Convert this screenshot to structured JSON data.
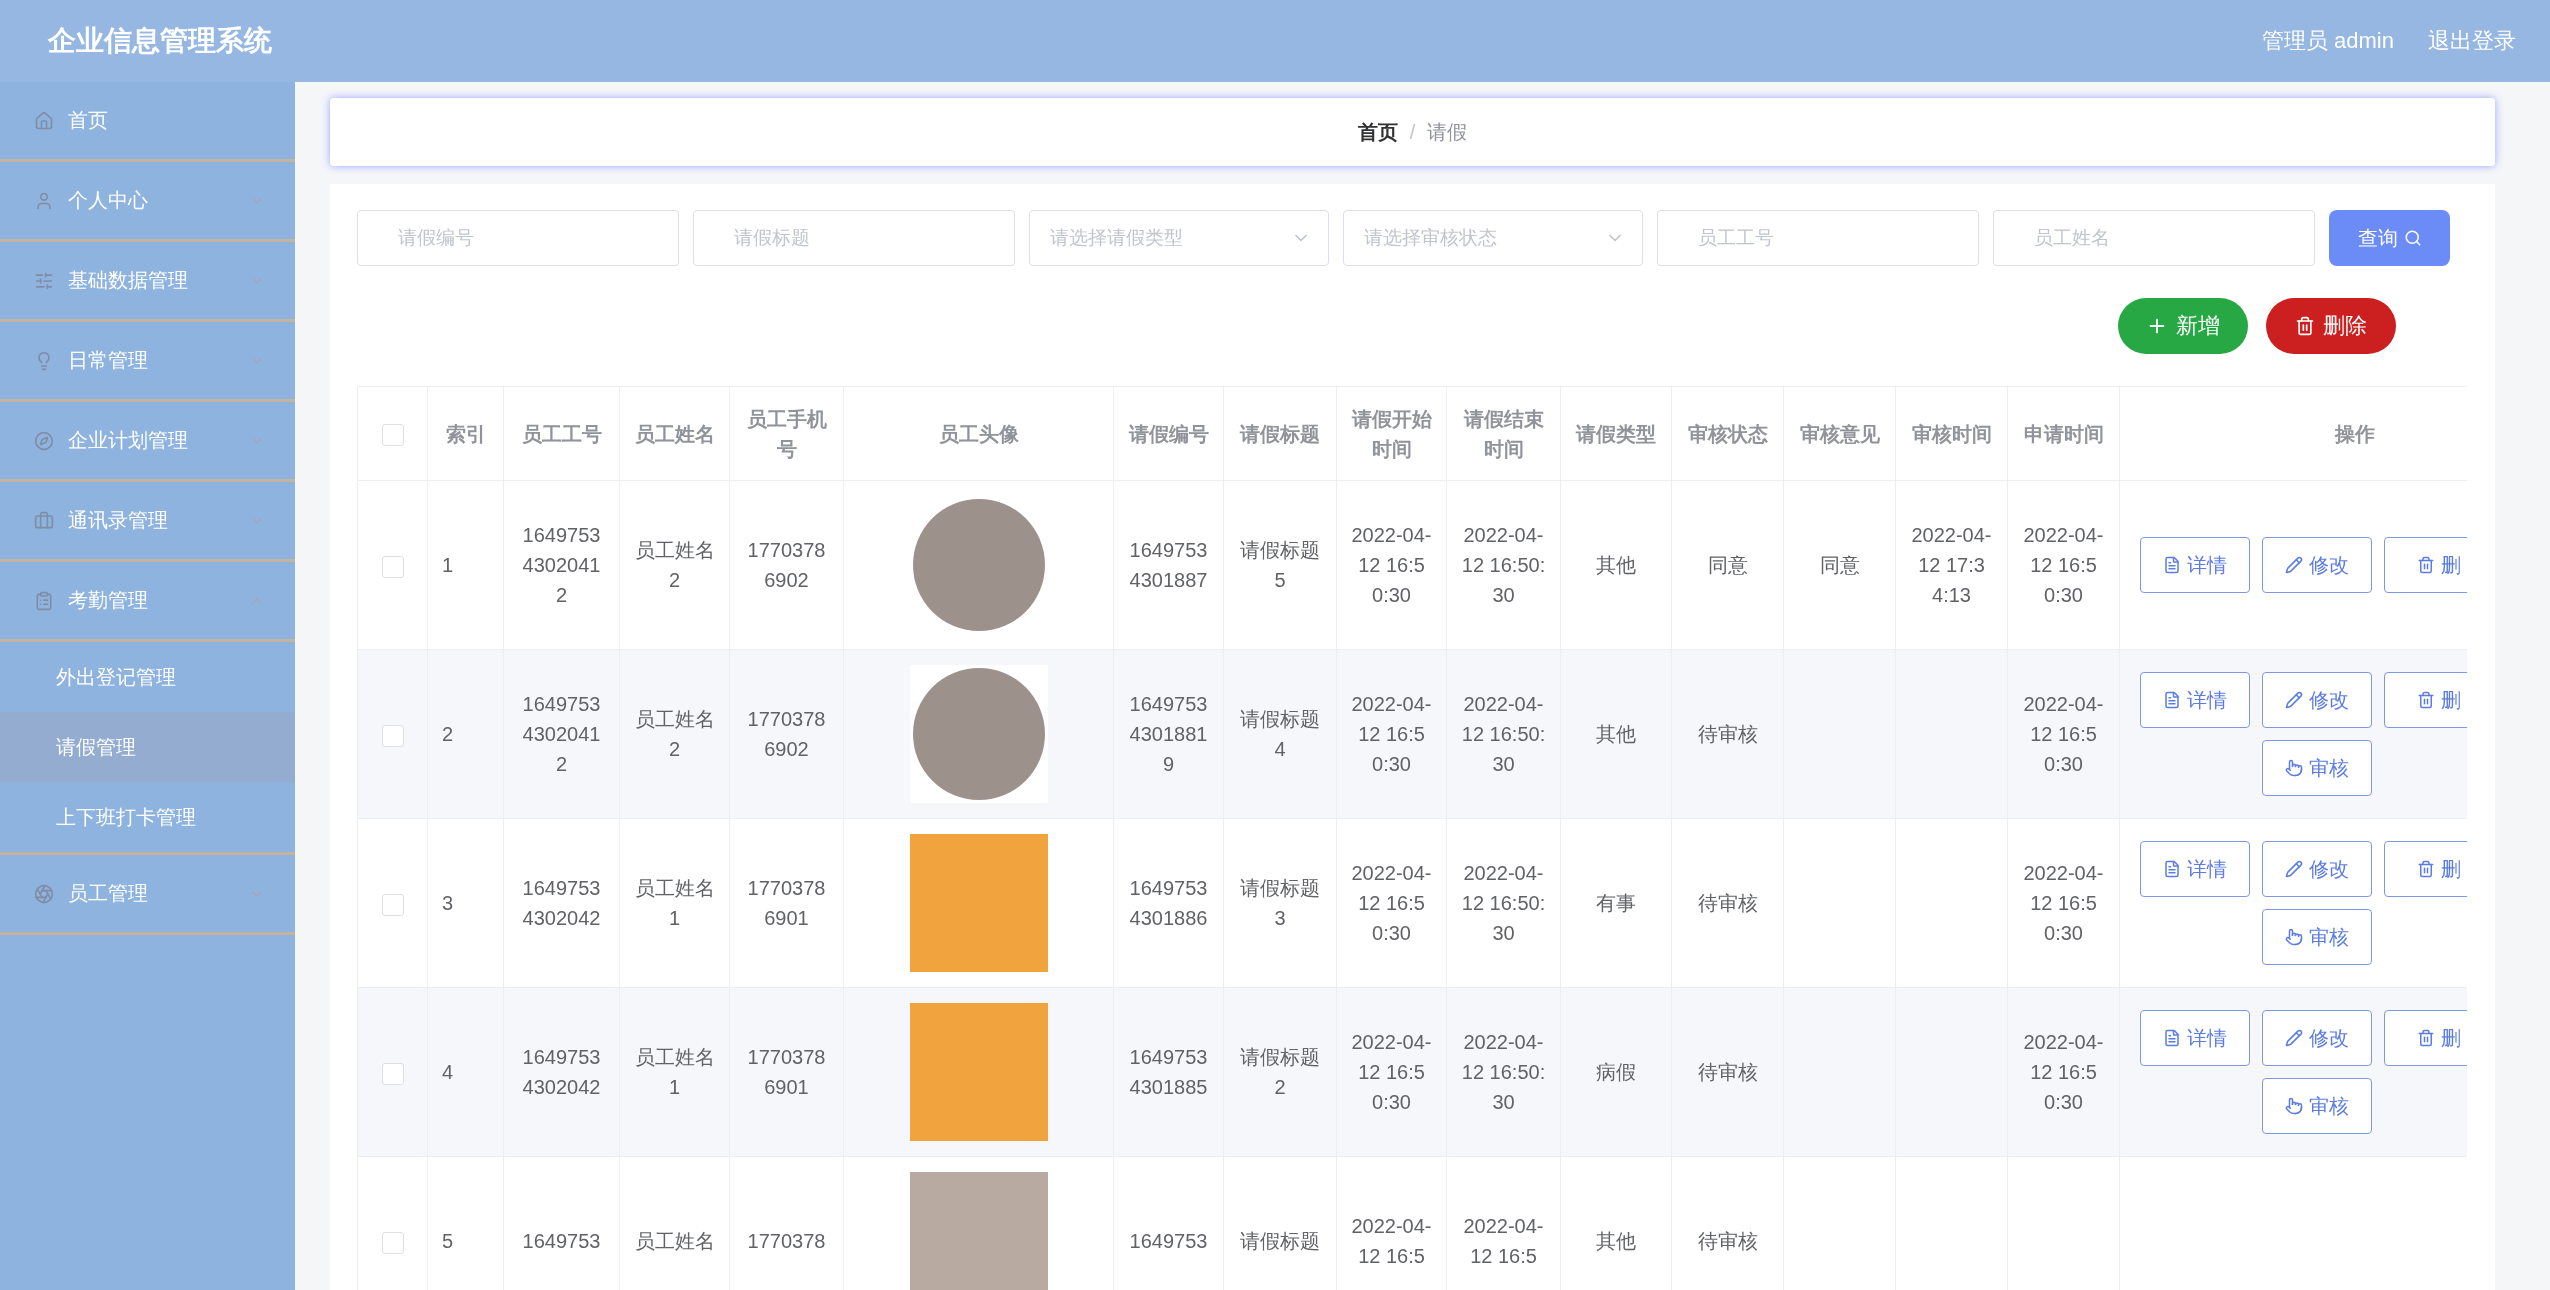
{
  "header": {
    "title": "企业信息管理系统",
    "user": "管理员 admin",
    "logout": "退出登录"
  },
  "sidebar": {
    "items": [
      {
        "label": "首页",
        "selected": false
      },
      {
        "label": "个人中心",
        "selected": false,
        "expanded": false
      },
      {
        "label": "基础数据管理",
        "selected": false,
        "expanded": false
      },
      {
        "label": "日常管理",
        "selected": false,
        "expanded": false
      },
      {
        "label": "企业计划管理",
        "selected": false,
        "expanded": false
      },
      {
        "label": "通讯录管理",
        "selected": false,
        "expanded": false
      },
      {
        "label": "考勤管理",
        "selected": false,
        "expanded": true,
        "children": [
          {
            "label": "外出登记管理",
            "selected": false
          },
          {
            "label": "请假管理",
            "selected": true
          },
          {
            "label": "上下班打卡管理",
            "selected": false
          }
        ]
      },
      {
        "label": "员工管理",
        "selected": false,
        "expanded": false
      }
    ]
  },
  "breadcrumb": {
    "items": [
      "首页",
      "请假"
    ],
    "separator": "/"
  },
  "filters": [
    {
      "kind": "input",
      "placeholder": "请假编号"
    },
    {
      "kind": "input",
      "placeholder": "请假标题"
    },
    {
      "kind": "select",
      "placeholder": "请选择请假类型"
    },
    {
      "kind": "select",
      "placeholder": "请选择审核状态"
    },
    {
      "kind": "input",
      "placeholder": "员工工号"
    },
    {
      "kind": "input",
      "placeholder": "员工姓名"
    }
  ],
  "search_button": "查询",
  "toolbar": [
    {
      "kind": "add",
      "label": "新增"
    },
    {
      "kind": "delete",
      "label": "删除"
    }
  ],
  "table": {
    "all_selected": false,
    "columns": [
      "索引",
      "员工工号",
      "员工姓名",
      "员工手机号",
      "员工头像",
      "请假编号",
      "请假标题",
      "请假开始时间",
      "请假结束时间",
      "请假类型",
      "审核状态",
      "审核意见",
      "审核时间",
      "申请时间",
      "操作"
    ],
    "rows": [
      {
        "selected": false,
        "cells": [
          "1",
          "164975343020412",
          "员工姓名2",
          "17703786902",
          null,
          "16497534301887",
          "请假标题5",
          "2022-04-12 16:50:30",
          "2022-04-12 16:50:30",
          "其他",
          "同意",
          "同意",
          "2022-04-12 17:34:13",
          "2022-04-12 16:50:30"
        ],
        "avatar": {
          "kind": "round"
        },
        "actions": [
          {
            "kind": "detail",
            "label": "详情"
          },
          {
            "kind": "edit",
            "label": "修改"
          },
          {
            "kind": "delete",
            "label": "删"
          }
        ]
      },
      {
        "selected": false,
        "cells": [
          "2",
          "164975343020412",
          "员工姓名2",
          "17703786902",
          null,
          "164975343018819",
          "请假标题4",
          "2022-04-12 16:50:30",
          "2022-04-12 16:50:30",
          "其他",
          "待审核",
          "",
          "",
          "2022-04-12 16:50:30"
        ],
        "avatar": {
          "kind": "round-framed"
        },
        "actions": [
          {
            "kind": "detail",
            "label": "详情"
          },
          {
            "kind": "edit",
            "label": "修改"
          },
          {
            "kind": "delete",
            "label": "删"
          },
          {
            "kind": "review",
            "label": "审核"
          }
        ]
      },
      {
        "selected": false,
        "cells": [
          "3",
          "16497534302042",
          "员工姓名1",
          "17703786901",
          null,
          "16497534301886",
          "请假标题3",
          "2022-04-12 16:50:30",
          "2022-04-12 16:50:30",
          "有事",
          "待审核",
          "",
          "",
          "2022-04-12 16:50:30"
        ],
        "avatar": {
          "kind": "cartoon"
        },
        "actions": [
          {
            "kind": "detail",
            "label": "详情"
          },
          {
            "kind": "edit",
            "label": "修改"
          },
          {
            "kind": "delete",
            "label": "删"
          },
          {
            "kind": "review",
            "label": "审核"
          }
        ]
      },
      {
        "selected": false,
        "cells": [
          "4",
          "16497534302042",
          "员工姓名1",
          "17703786901",
          null,
          "16497534301885",
          "请假标题2",
          "2022-04-12 16:50:30",
          "2022-04-12 16:50:30",
          "病假",
          "待审核",
          "",
          "",
          "2022-04-12 16:50:30"
        ],
        "avatar": {
          "kind": "cartoon"
        },
        "actions": [
          {
            "kind": "detail",
            "label": "详情"
          },
          {
            "kind": "edit",
            "label": "修改"
          },
          {
            "kind": "delete",
            "label": "删"
          },
          {
            "kind": "review",
            "label": "审核"
          }
        ]
      },
      {
        "selected": false,
        "cells": [
          "5",
          "1649753",
          "员工姓名",
          "1770378",
          null,
          "1649753",
          "请假标题",
          "2022-04-12 16:5",
          "2022-04-12 16:5",
          "其他",
          "待审核",
          "",
          "",
          ""
        ],
        "avatar": {
          "kind": "photo"
        },
        "actions": []
      }
    ]
  }
}
